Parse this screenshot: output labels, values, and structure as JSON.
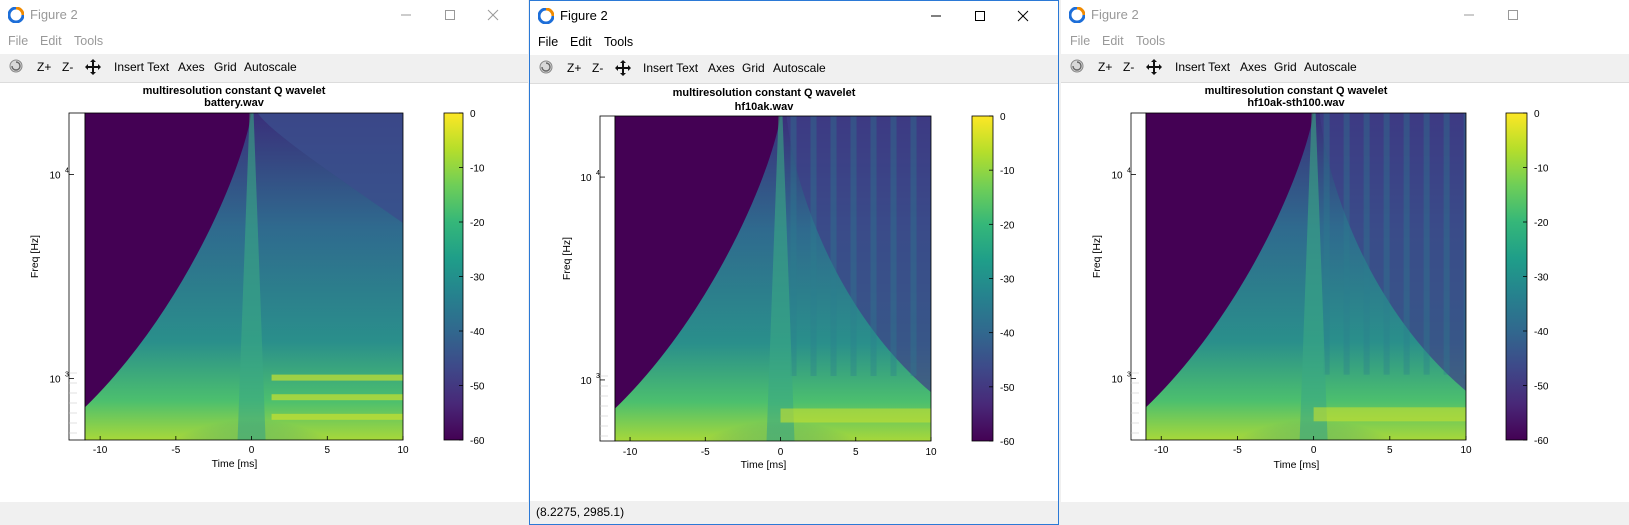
{
  "windows": [
    {
      "title": "Figure 2",
      "state": "inactive",
      "menu": [
        "File",
        "Edit",
        "Tools"
      ],
      "toolbar": [
        "Z+",
        "Z-",
        "Insert Text",
        "Axes",
        "Grid",
        "Autoscale"
      ],
      "plot_title_line1": "multiresolution constant Q wavelet",
      "plot_title_line2": "battery.wav",
      "status": ""
    },
    {
      "title": "Figure 2",
      "state": "active",
      "menu": [
        "File",
        "Edit",
        "Tools"
      ],
      "toolbar": [
        "Z+",
        "Z-",
        "Insert Text",
        "Axes",
        "Grid",
        "Autoscale"
      ],
      "plot_title_line1": "multiresolution constant Q wavelet",
      "plot_title_line2": "hf10ak.wav",
      "status": "(8.2275, 2985.1)"
    },
    {
      "title": "Figure 2",
      "state": "inactive",
      "menu": [
        "File",
        "Edit",
        "Tools"
      ],
      "toolbar": [
        "Z+",
        "Z-",
        "Insert Text",
        "Axes",
        "Grid",
        "Autoscale"
      ],
      "plot_title_line1": "multiresolution constant Q wavelet",
      "plot_title_line2": "hf10ak-sth100.wav",
      "status": ""
    }
  ],
  "chart_data": [
    {
      "type": "heatmap",
      "title": "multiresolution constant Q wavelet battery.wav",
      "xlabel": "Time [ms]",
      "ylabel": "Freq [Hz]",
      "xlim": [
        -11,
        10
      ],
      "xticks": [
        -10,
        -5,
        0,
        5,
        10
      ],
      "yscale": "log",
      "ylim": [
        500,
        20000
      ],
      "yticks": [
        1000,
        10000
      ],
      "yticklabels": [
        "10",
        "10"
      ],
      "yticklabel_exponents": [
        "3",
        "4"
      ],
      "colorbar": {
        "range": [
          -60,
          0
        ],
        "ticks": [
          0,
          -10,
          -20,
          -30,
          -40,
          -50,
          -60
        ],
        "colormap": "viridis"
      }
    },
    {
      "type": "heatmap",
      "title": "multiresolution constant Q wavelet hf10ak.wav",
      "xlabel": "Time [ms]",
      "ylabel": "Freq [Hz]",
      "xlim": [
        -11,
        10
      ],
      "xticks": [
        -10,
        -5,
        0,
        5,
        10
      ],
      "yscale": "log",
      "ylim": [
        500,
        20000
      ],
      "yticks": [
        1000,
        10000
      ],
      "yticklabels": [
        "10",
        "10"
      ],
      "yticklabel_exponents": [
        "3",
        "4"
      ],
      "colorbar": {
        "range": [
          -60,
          0
        ],
        "ticks": [
          0,
          -10,
          -20,
          -30,
          -40,
          -50,
          -60
        ],
        "colormap": "viridis"
      }
    },
    {
      "type": "heatmap",
      "title": "multiresolution constant Q wavelet hf10ak-sth100.wav",
      "xlabel": "Time [ms]",
      "ylabel": "Freq [Hz]",
      "xlim": [
        -11,
        10
      ],
      "xticks": [
        -10,
        -5,
        0,
        5,
        10
      ],
      "yscale": "log",
      "ylim": [
        500,
        20000
      ],
      "yticks": [
        1000,
        10000
      ],
      "yticklabels": [
        "10",
        "10"
      ],
      "yticklabel_exponents": [
        "3",
        "4"
      ],
      "colorbar": {
        "range": [
          -60,
          0
        ],
        "ticks": [
          0,
          -10,
          -20,
          -30,
          -40,
          -50,
          -60
        ],
        "colormap": "viridis"
      }
    }
  ]
}
